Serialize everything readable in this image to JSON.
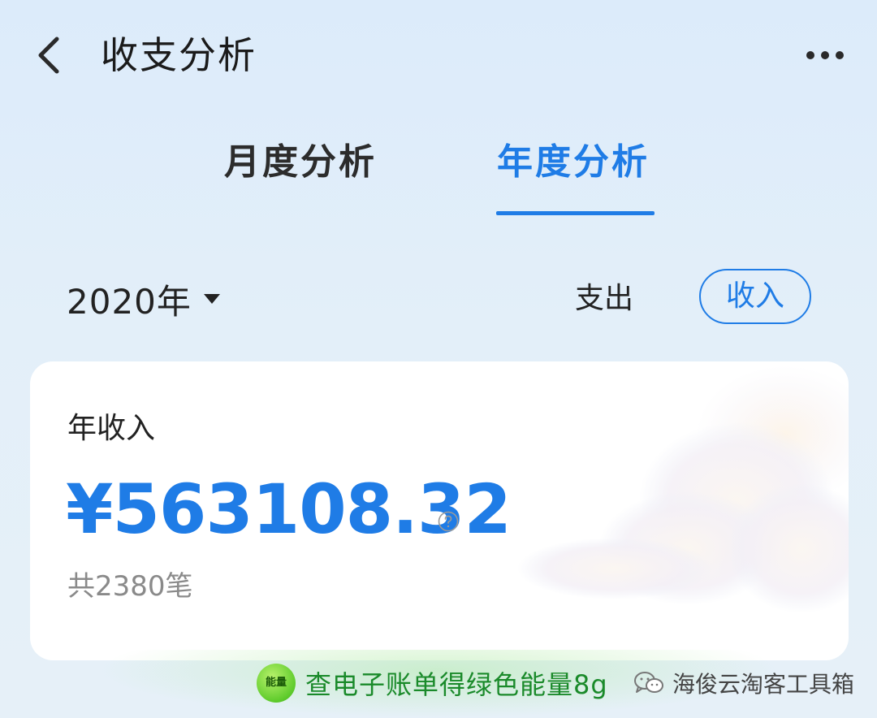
{
  "header": {
    "title": "收支分析",
    "back_icon": "chevron-left-icon",
    "more_icon": "more-horizontal-icon"
  },
  "tabs": [
    {
      "label": "月度分析",
      "active": false
    },
    {
      "label": "年度分析",
      "active": true
    }
  ],
  "filters": {
    "year": "2020年",
    "expense_label": "支出",
    "income_label": "收入",
    "selected": "收入"
  },
  "summary": {
    "label": "年收入",
    "amount": "¥563108.32",
    "count": "共2380笔"
  },
  "promo": {
    "badge": "能量",
    "text": "查电子账单得绿色能量8g"
  },
  "watermark": {
    "text": "海俊云淘客工具箱"
  },
  "colors": {
    "accent": "#1f7ce6",
    "promo_green": "#1a8a2a",
    "muted": "#8a8a8a"
  }
}
